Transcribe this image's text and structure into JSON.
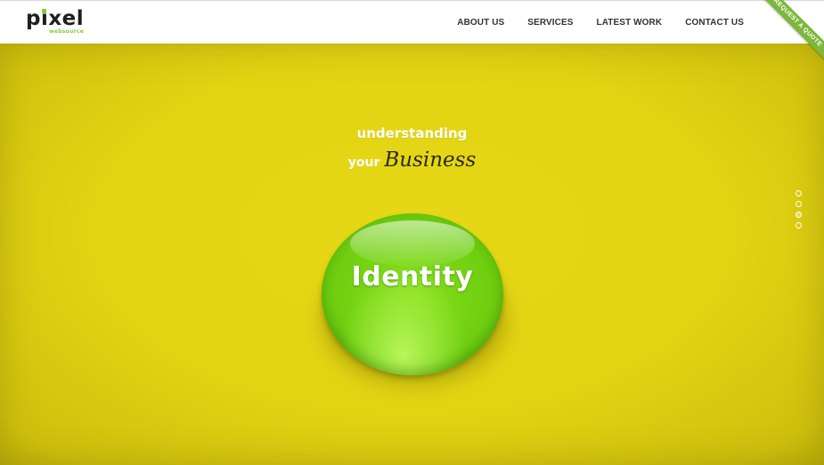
{
  "header": {
    "logo": {
      "word": "pixel",
      "sub": "websource"
    },
    "nav": [
      {
        "label": "ABOUT US"
      },
      {
        "label": "SERVICES"
      },
      {
        "label": "LATEST WORK"
      },
      {
        "label": "CONTACT US"
      }
    ],
    "ribbon_label": "REQUEST A QUOTE"
  },
  "hero": {
    "line1": "understanding",
    "line2_prefix": "your",
    "line2_emphasis": "Business",
    "bubble_label": "Identity",
    "slides_count": 4,
    "active_slide": 3
  },
  "colors": {
    "hero_background": "#e3d514",
    "bubble_green": "#86e01a",
    "ribbon_green": "#7db73b",
    "logo_accent": "#8cc63f"
  }
}
